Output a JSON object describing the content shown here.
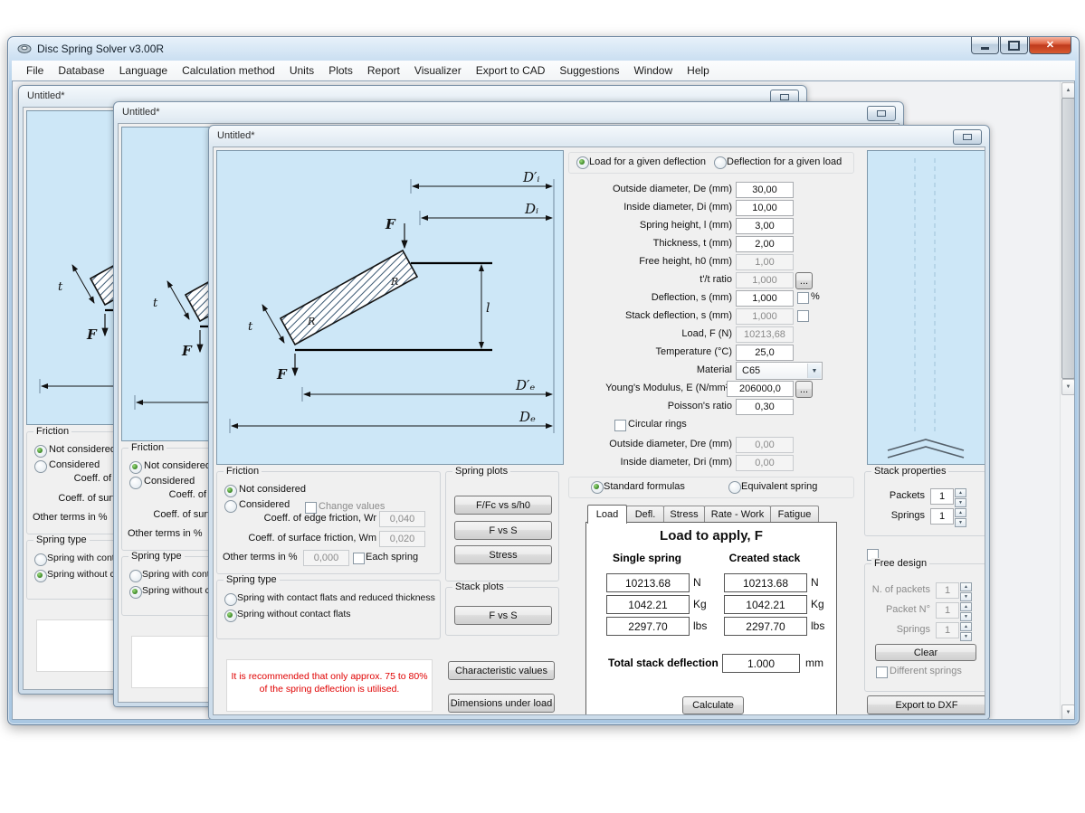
{
  "app": {
    "title": "Disc Spring Solver v3.00R",
    "child_title": "Untitled*",
    "menu": [
      "File",
      "Database",
      "Language",
      "Calculation method",
      "Units",
      "Plots",
      "Report",
      "Visualizer",
      "Export to CAD",
      "Suggestions",
      "Window",
      "Help"
    ]
  },
  "icons": {
    "close": "✕",
    "dropdown": "▼",
    "up": "▲",
    "down": "▼",
    "more": "..."
  },
  "mode": {
    "option1": "Load for a given deflection",
    "option2": "Deflection for a given load"
  },
  "params": [
    {
      "label": "Outside diameter, De (mm)",
      "value": "30,00"
    },
    {
      "label": "Inside diameter, Di (mm)",
      "value": "10,00"
    },
    {
      "label": "Spring height, l (mm)",
      "value": "3,00"
    },
    {
      "label": "Thickness, t (mm)",
      "value": "2,00"
    },
    {
      "label": "Free height, h0 (mm)",
      "value": "1,00"
    },
    {
      "label": "t'/t ratio",
      "value": "1,000"
    },
    {
      "label": "Deflection, s (mm)",
      "value": "1,000",
      "suffix": "%"
    },
    {
      "label": "Stack deflection, s (mm)",
      "value": "1,000"
    },
    {
      "label": "Load, F (N)",
      "value": "10213,68"
    },
    {
      "label": "Temperature (°C)",
      "value": "25,0"
    },
    {
      "label": "Material",
      "value": "C65"
    },
    {
      "label": "Young's Modulus, E (N/mm²)",
      "value": "206000,0"
    },
    {
      "label": "Poisson's ratio",
      "value": "0,30"
    },
    {
      "label": "Circular rings"
    },
    {
      "label": "Outside diameter, Dre (mm)",
      "value": "0,00"
    },
    {
      "label": "Inside diameter, Dri (mm)",
      "value": "0,00"
    }
  ],
  "friction": {
    "title": "Friction",
    "not_considered": "Not considered",
    "considered": "Considered",
    "change_values": "Change values",
    "edge_label": "Coeff. of edge friction, Wr",
    "edge_value": "0,040",
    "surface_label": "Coeff. of surface friction, Wm",
    "surface_value": "0,020",
    "other_label": "Other terms in %",
    "other_value": "0,000",
    "each_spring": "Each spring"
  },
  "spring_type": {
    "title": "Spring type",
    "option1": "Spring with contact flats and reduced thickness",
    "option2": "Spring without contact flats"
  },
  "warning": {
    "line1": "It is recommended that only approx. 75 to 80%",
    "line2": "of the spring deflection is utilised."
  },
  "spring_plots": {
    "title": "Spring plots",
    "buttons": [
      "F/Fc vs s/h0",
      "F vs S",
      "Stress"
    ]
  },
  "stack_plots": {
    "title": "Stack plots",
    "button": "F vs S"
  },
  "actions": {
    "characteristic": "Characteristic values",
    "dimensions": "Dimensions under load",
    "calculate": "Calculate",
    "clear": "Clear",
    "export_dxf": "Export to DXF"
  },
  "formulas": {
    "standard": "Standard formulas",
    "equivalent": "Equivalent spring"
  },
  "tabs": [
    "Load",
    "Defl.",
    "Stress",
    "Rate - Work",
    "Fatigue"
  ],
  "results": {
    "title": "Load to apply, F",
    "col1": "Single spring",
    "col2": "Created stack",
    "rows": [
      {
        "spring": "10213.68",
        "stack": "10213.68",
        "unit": "N"
      },
      {
        "spring": "1042.21",
        "stack": "1042.21",
        "unit": "Kg"
      },
      {
        "spring": "2297.70",
        "stack": "2297.70",
        "unit": "lbs"
      }
    ],
    "total_label": "Total stack deflection",
    "total_value": "1.000",
    "total_unit": "mm"
  },
  "stack_properties": {
    "title": "Stack properties",
    "packets_label": "Packets",
    "packets_value": "1",
    "springs_label": "Springs",
    "springs_value": "1"
  },
  "free_design": {
    "title": "Free design",
    "n_packets_label": "N. of packets",
    "n_packets_value": "1",
    "packet_n_label": "Packet N°",
    "packet_n_value": "1",
    "springs_label": "Springs",
    "springs_value": "1",
    "different_springs": "Different springs"
  },
  "diagram": {
    "f": "F",
    "l": "l",
    "t": "t",
    "r": "R",
    "di_prime": "D′ᵢ",
    "di": "Dᵢ",
    "de_prime": "D′ₑ",
    "de": "Dₑ"
  }
}
